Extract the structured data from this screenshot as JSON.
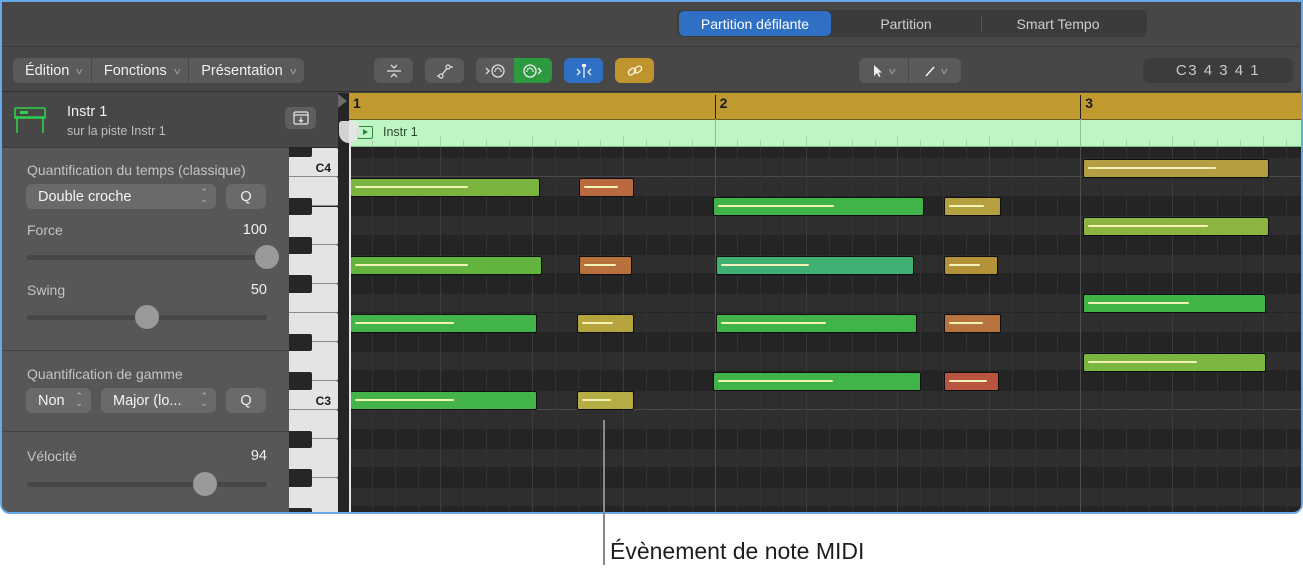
{
  "view_tabs": [
    {
      "label": "Partition défilante",
      "active": true
    },
    {
      "label": "Partition",
      "active": false
    },
    {
      "label": "Smart Tempo",
      "active": false
    }
  ],
  "menus": [
    {
      "label": "Édition"
    },
    {
      "label": "Fonctions"
    },
    {
      "label": "Présentation"
    }
  ],
  "toolbar_icons": [
    "collapse-vertical-icon",
    "automation-curve-icon",
    "midi-in-icon",
    "midi-out-icon",
    "catch-playhead-icon",
    "link-icon"
  ],
  "toolbar_colors": {
    "midi_out_active": "#2e9a3f",
    "catch_active": "#2f6fc4",
    "link_active": "#c0942c"
  },
  "tools": {
    "pointer": "pointer-tool-icon",
    "pencil": "pencil-tool-icon"
  },
  "position_display": "C3  4 3 4 1",
  "inspector": {
    "title": "Instr 1",
    "subtitle": "sur la piste Instr 1",
    "time_quantize": {
      "label": "Quantification du temps (classique)",
      "value": "Double croche",
      "q_label": "Q"
    },
    "strength": {
      "label": "Force",
      "value": "100",
      "fraction": 1.0
    },
    "swing": {
      "label": "Swing",
      "value": "50",
      "fraction": 0.5
    },
    "scale_quantize": {
      "label": "Quantification de gamme",
      "mode": "Non",
      "scale": "Major (lo...",
      "q_label": "Q"
    },
    "velocity": {
      "label": "Vélocité",
      "value": "94",
      "fraction": 0.74
    }
  },
  "piano": {
    "labels": [
      {
        "text": "C4",
        "row": 1
      },
      {
        "text": "C3",
        "row": 13
      }
    ]
  },
  "ruler": {
    "bars": [
      "1",
      "2",
      "3"
    ]
  },
  "region": {
    "name": "Instr 1",
    "color": "#bdf6c4"
  },
  "notes_info": "row: semitones below the top visible row (row 1 = C4, row 13 = C3); start/length in sixteenths from bar 1",
  "notes": [
    {
      "row": 2,
      "start": 0,
      "len": 8.3,
      "color": "#7ab43e",
      "vel": 0.63
    },
    {
      "row": 2,
      "start": 10,
      "len": 2.45,
      "color": "#bb6a3f",
      "vel": 0.75
    },
    {
      "row": 3,
      "start": 15.9,
      "len": 9.2,
      "color": "#40b448",
      "vel": 0.58
    },
    {
      "row": 3,
      "start": 26,
      "len": 2.5,
      "color": "#b4a03e",
      "vel": 0.75
    },
    {
      "row": 1,
      "start": 32.1,
      "len": 8.1,
      "color": "#b59e42",
      "vel": 0.73
    },
    {
      "row": 4,
      "start": 32.1,
      "len": 8.1,
      "color": "#8cb43e",
      "vel": 0.68
    },
    {
      "row": 6,
      "start": 0,
      "len": 8.4,
      "color": "#62b43e",
      "vel": 0.62
    },
    {
      "row": 6,
      "start": 10,
      "len": 2.35,
      "color": "#b8703c",
      "vel": 0.75
    },
    {
      "row": 6,
      "start": 16,
      "len": 8.7,
      "color": "#3eb073",
      "vel": 0.47
    },
    {
      "row": 6,
      "start": 26,
      "len": 2.35,
      "color": "#b4923a",
      "vel": 0.7
    },
    {
      "row": 8,
      "start": 32.1,
      "len": 8.0,
      "color": "#40b444",
      "vel": 0.58
    },
    {
      "row": 9,
      "start": 0,
      "len": 8.2,
      "color": "#42b44a",
      "vel": 0.56
    },
    {
      "row": 9,
      "start": 9.95,
      "len": 2.5,
      "color": "#b6a43e",
      "vel": 0.65
    },
    {
      "row": 9,
      "start": 16,
      "len": 8.8,
      "color": "#40b448",
      "vel": 0.55
    },
    {
      "row": 9,
      "start": 26,
      "len": 2.5,
      "color": "#b8743e",
      "vel": 0.72
    },
    {
      "row": 11,
      "start": 32.1,
      "len": 8.0,
      "color": "#7ab640",
      "vel": 0.63
    },
    {
      "row": 12,
      "start": 15.9,
      "len": 9.1,
      "color": "#40b448",
      "vel": 0.58
    },
    {
      "row": 12,
      "start": 26,
      "len": 2.4,
      "color": "#b85440",
      "vel": 0.85
    },
    {
      "row": 13,
      "start": 0,
      "len": 8.2,
      "color": "#42b44a",
      "vel": 0.56
    },
    {
      "row": 13,
      "start": 9.95,
      "len": 2.5,
      "color": "#b4ac44",
      "vel": 0.6
    }
  ],
  "callout": {
    "text": "Évènement de note MIDI"
  }
}
